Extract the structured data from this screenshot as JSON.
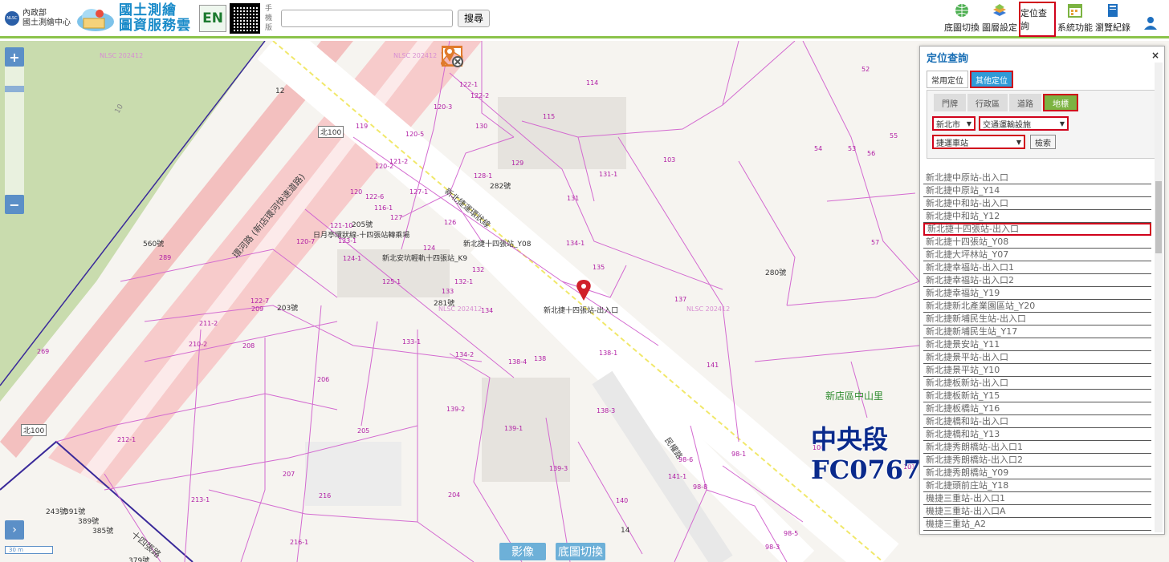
{
  "header": {
    "agency_line1": "內政部",
    "agency_line2": "國土測繪中心",
    "agency_badge": "NLSC",
    "brand_line1": "國土測繪",
    "brand_line2": "圖資服務雲",
    "en_label": "EN",
    "mobile_label": "手機版",
    "search_placeholder": "",
    "search_button": "搜尋"
  },
  "tools": [
    {
      "label": "底圖切換",
      "icon": "globe-icon",
      "color": "#4caf50"
    },
    {
      "label": "圖層設定",
      "icon": "layers-icon",
      "color": "#e6a23c"
    },
    {
      "label": "定位查詢",
      "icon": "locate-icon",
      "color": "#8bc34a",
      "active": true
    },
    {
      "label": "系統功能",
      "icon": "calendar-icon",
      "color": "#7cb342"
    },
    {
      "label": "瀏覽紀錄",
      "icon": "book-icon",
      "color": "#1e6fbf"
    },
    {
      "label": "",
      "icon": "user-icon",
      "color": "#1e6fbf"
    }
  ],
  "map": {
    "zoom_in": "+",
    "zoom_out": "−",
    "expand": "›",
    "scale": "30 m",
    "watermark": "NLSC 202412",
    "labels": {
      "road_expressway": "環河路 (新店環河快速道路)",
      "road_metro": "新北捷運環狀線",
      "road_mingquan": "民權路",
      "road_shisizhang": "十四張路",
      "bei100": "北100",
      "station_y08": "新北捷十四張站_Y08",
      "station_k9": "新北安坑輕軌十四張站_K9",
      "station_exit": "新北捷十四張站-出入口",
      "riyue": "日月亭環狀線-十四張站轉乘場",
      "village": "新店區中山里",
      "no205": "205號",
      "no282": "282號",
      "no560": "560號",
      "no203": "203號",
      "no281": "281號",
      "no280": "280號",
      "no243": "243號",
      "no391": "391號",
      "no389": "389號",
      "no385": "385號",
      "no379": "379號",
      "no12": "12",
      "no14": "14",
      "no10": "10"
    },
    "parcels": [
      "114",
      "115",
      "122-1",
      "122-2",
      "120-3",
      "120-5",
      "130",
      "119",
      "120-2",
      "121-2",
      "128-1",
      "129",
      "131-1",
      "103",
      "52",
      "53",
      "120",
      "122-6",
      "127-1",
      "131",
      "116-1",
      "127",
      "126",
      "134-1",
      "121-10",
      "120-7",
      "123-1",
      "124",
      "124-1",
      "125-1",
      "132-1",
      "132",
      "135",
      "137",
      "289",
      "133",
      "134",
      "122-7",
      "209",
      "211-2",
      "210-2",
      "208",
      "133-1",
      "134-2",
      "138",
      "138-4",
      "138-1",
      "141",
      "206",
      "139-2",
      "138-3",
      "139-1",
      "212-1",
      "205",
      "207",
      "139-3",
      "213-1",
      "216",
      "204",
      "140",
      "216-1",
      "98-1",
      "98-6",
      "98-8",
      "98-5",
      "98-3",
      "100",
      "141-1",
      "101",
      "57",
      "54",
      "56",
      "55",
      "269"
    ],
    "district_line1": "中央段",
    "district_line2": "FC0767",
    "btn_image": "影像",
    "btn_basemap": "底圖切換"
  },
  "panel": {
    "title": "定位查詢",
    "close": "×",
    "tabs1": [
      {
        "label": "常用定位",
        "active": false
      },
      {
        "label": "其他定位",
        "active": true
      }
    ],
    "tabs2": [
      {
        "label": "門牌",
        "active": false
      },
      {
        "label": "行政區",
        "active": false
      },
      {
        "label": "道路",
        "active": false
      },
      {
        "label": "地標",
        "active": true
      }
    ],
    "select_city": "新北市",
    "select_category": "交通運輸設施",
    "select_sub": "捷運車站",
    "query_button": "檢索",
    "results": [
      "新北捷中原站-出入口",
      "新北捷中原站_Y14",
      "新北捷中和站-出入口",
      "新北捷中和站_Y12",
      "新北捷十四張站-出入口",
      "新北捷十四張站_Y08",
      "新北捷大坪林站_Y07",
      "新北捷幸福站-出入口1",
      "新北捷幸福站-出入口2",
      "新北捷幸福站_Y19",
      "新北捷新北產業園區站_Y20",
      "新北捷新埔民生站-出入口",
      "新北捷新埔民生站_Y17",
      "新北捷景安站_Y11",
      "新北捷景平站-出入口",
      "新北捷景平站_Y10",
      "新北捷板新站-出入口",
      "新北捷板新站_Y15",
      "新北捷板橋站_Y16",
      "新北捷橋和站-出入口",
      "新北捷橋和站_Y13",
      "新北捷秀朗橋站-出入口1",
      "新北捷秀朗橋站-出入口2",
      "新北捷秀朗橋站_Y09",
      "新北捷頭前庄站_Y18",
      "機捷三重站-出入口1",
      "機捷三重站-出入口A",
      "機捷三重站_A2"
    ],
    "highlighted_index": 4
  }
}
